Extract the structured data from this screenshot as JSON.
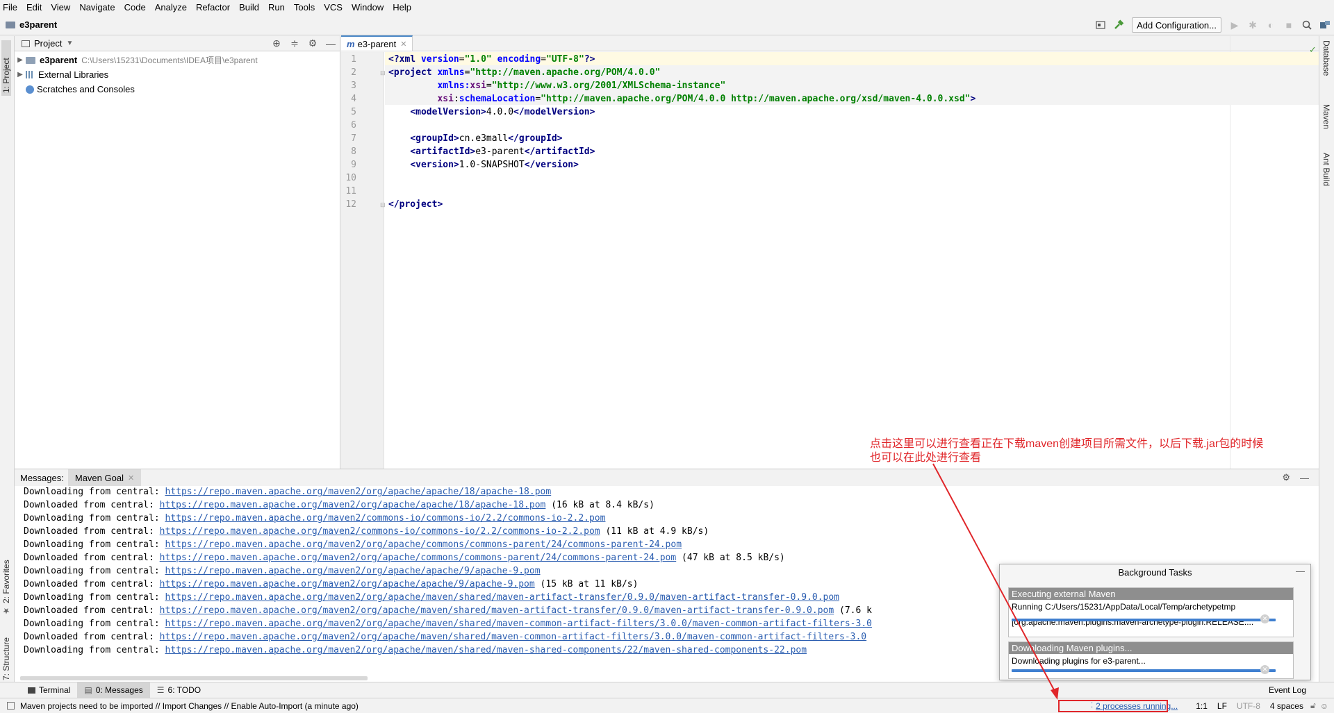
{
  "menu": [
    "File",
    "Edit",
    "View",
    "Navigate",
    "Code",
    "Analyze",
    "Refactor",
    "Build",
    "Run",
    "Tools",
    "VCS",
    "Window",
    "Help"
  ],
  "navbar": {
    "breadcrumb": "e3parent",
    "add_config": "Add Configuration..."
  },
  "left_tabs": {
    "project": "1: Project",
    "favorites": "2: Favorites",
    "structure": "7: Structure"
  },
  "right_tabs": {
    "database": "Database",
    "maven": "Maven",
    "ant": "Ant Build"
  },
  "project": {
    "header": "Project",
    "root_name": "e3parent",
    "root_path": "C:\\Users\\15231\\Documents\\IDEA项目\\e3parent",
    "external_libraries": "External Libraries",
    "scratches": "Scratches and Consoles"
  },
  "editor": {
    "tab_label": "e3-parent",
    "line_numbers": [
      "1",
      "2",
      "3",
      "4",
      "5",
      "6",
      "7",
      "8",
      "9",
      "10",
      "11",
      "12"
    ]
  },
  "messages": {
    "label": "Messages:",
    "tab": "Maven Goal",
    "lines": [
      {
        "prefix": "Downloading from central: ",
        "url": "https://repo.maven.apache.org/maven2/org/apache/apache/18/apache-18.pom",
        "suffix": ""
      },
      {
        "prefix": "Downloaded from central: ",
        "url": "https://repo.maven.apache.org/maven2/org/apache/apache/18/apache-18.pom",
        "suffix": " (16 kB at 8.4 kB/s)"
      },
      {
        "prefix": "Downloading from central: ",
        "url": "https://repo.maven.apache.org/maven2/commons-io/commons-io/2.2/commons-io-2.2.pom",
        "suffix": ""
      },
      {
        "prefix": "Downloaded from central: ",
        "url": "https://repo.maven.apache.org/maven2/commons-io/commons-io/2.2/commons-io-2.2.pom",
        "suffix": " (11 kB at 4.9 kB/s)"
      },
      {
        "prefix": "Downloading from central: ",
        "url": "https://repo.maven.apache.org/maven2/org/apache/commons/commons-parent/24/commons-parent-24.pom",
        "suffix": ""
      },
      {
        "prefix": "Downloaded from central: ",
        "url": "https://repo.maven.apache.org/maven2/org/apache/commons/commons-parent/24/commons-parent-24.pom",
        "suffix": " (47 kB at 8.5 kB/s)"
      },
      {
        "prefix": "Downloading from central: ",
        "url": "https://repo.maven.apache.org/maven2/org/apache/apache/9/apache-9.pom",
        "suffix": ""
      },
      {
        "prefix": "Downloaded from central: ",
        "url": "https://repo.maven.apache.org/maven2/org/apache/apache/9/apache-9.pom",
        "suffix": " (15 kB at 11 kB/s)"
      },
      {
        "prefix": "Downloading from central: ",
        "url": "https://repo.maven.apache.org/maven2/org/apache/maven/shared/maven-artifact-transfer/0.9.0/maven-artifact-transfer-0.9.0.pom",
        "suffix": ""
      },
      {
        "prefix": "Downloaded from central: ",
        "url": "https://repo.maven.apache.org/maven2/org/apache/maven/shared/maven-artifact-transfer/0.9.0/maven-artifact-transfer-0.9.0.pom",
        "suffix": " (7.6 k"
      },
      {
        "prefix": "Downloading from central: ",
        "url": "https://repo.maven.apache.org/maven2/org/apache/maven/shared/maven-common-artifact-filters/3.0.0/maven-common-artifact-filters-3.0",
        "suffix": ""
      },
      {
        "prefix": "Downloaded from central: ",
        "url": "https://repo.maven.apache.org/maven2/org/apache/maven/shared/maven-common-artifact-filters/3.0.0/maven-common-artifact-filters-3.0",
        "suffix": ""
      },
      {
        "prefix": "Downloading from central: ",
        "url": "https://repo.maven.apache.org/maven2/org/apache/maven/shared/maven-shared-components/22/maven-shared-components-22.pom",
        "suffix": ""
      }
    ]
  },
  "bottom_tabs": {
    "terminal": "Terminal",
    "messages": "0: Messages",
    "todo": "6: TODO",
    "event_log": "Event Log"
  },
  "status": {
    "message": "Maven projects need to be imported // Import Changes // Enable Auto-Import (a minute ago)",
    "processes": "2 processes running...",
    "position": "1:1",
    "line_sep": "LF",
    "encoding": "UTF-8",
    "indent": "4 spaces"
  },
  "background_tasks": {
    "title": "Background Tasks",
    "task1_title": "Executing external Maven",
    "task1_line1": "Running C:/Users/15231/AppData/Local/Temp/archetypetmp",
    "task1_line2": "[org.apache.maven.plugins:maven-archetype-plugin:RELEASE:...",
    "task2_title": "Downloading Maven plugins...",
    "task2_line1": "Downloading plugins for e3-parent..."
  },
  "annotation": {
    "line1": "点击这里可以进行查看正在下载maven创建项目所需文件，以后下载.jar包的时候",
    "line2": "也可以在此处进行查看"
  },
  "colors": {
    "accent": "#4a88c7",
    "annotation_red": "#e0262a",
    "link": "#2a5db0",
    "progress": "#3f7fd0"
  }
}
